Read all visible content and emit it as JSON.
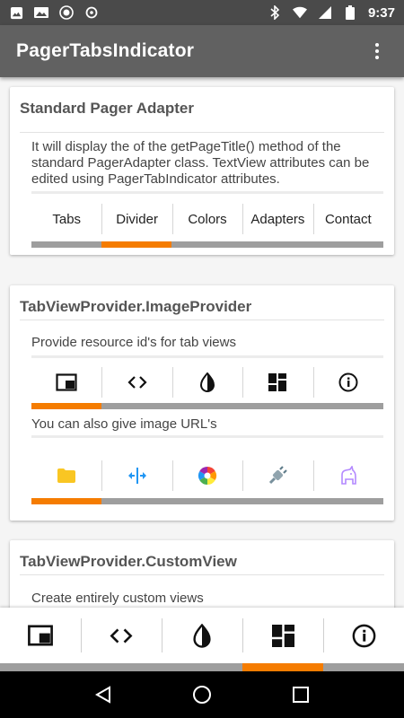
{
  "status_bar": {
    "time": "9:37",
    "left_icons": [
      "image-icon",
      "photo-icon",
      "record-icon",
      "sync-icon"
    ],
    "right_icons": [
      "bluetooth-icon",
      "wifi-icon",
      "signal-icon",
      "battery-icon"
    ]
  },
  "app_bar": {
    "title": "PagerTabsIndicator",
    "menu_icon": "overflow-menu-icon"
  },
  "cards": [
    {
      "title": "Standard Pager Adapter",
      "description": "It will display the of the getPageTitle() method of the standard PagerAdapter class. TextView attributes can be edited using PagerTabIndicator attributes.",
      "tabs": [
        "Tabs",
        "Divider",
        "Colors",
        "Adapters",
        "Contact"
      ],
      "selected_tab": 1,
      "tab_count": 5
    },
    {
      "title": "TabViewProvider.ImageProvider",
      "description": "Provide resource id's for tab views",
      "tab_icons": [
        "tab-window-icon",
        "code-icon",
        "contrast-icon",
        "dashboard-icon",
        "info-icon"
      ],
      "selected_tab": 0,
      "secondary_description": "You can also give image URL's",
      "url_icons": [
        "folder-icon",
        "resize-icon",
        "color-wheel-icon",
        "plug-icon",
        "unicorn-icon"
      ],
      "url_selected_tab": 0
    },
    {
      "title": "TabViewProvider.CustomView",
      "description": "Create entirely custom views"
    }
  ],
  "bottom_tabs": {
    "icons": [
      "tab-window-icon",
      "code-icon",
      "contrast-icon",
      "dashboard-icon",
      "info-icon"
    ],
    "selected_tab": 3
  },
  "nav_bar": {
    "buttons": [
      "back-icon",
      "home-icon",
      "recents-icon"
    ]
  },
  "colors": {
    "accent": "#f57c00",
    "track": "#9e9e9e",
    "app_bar": "#616161",
    "status_bar": "#4a4a4a"
  }
}
